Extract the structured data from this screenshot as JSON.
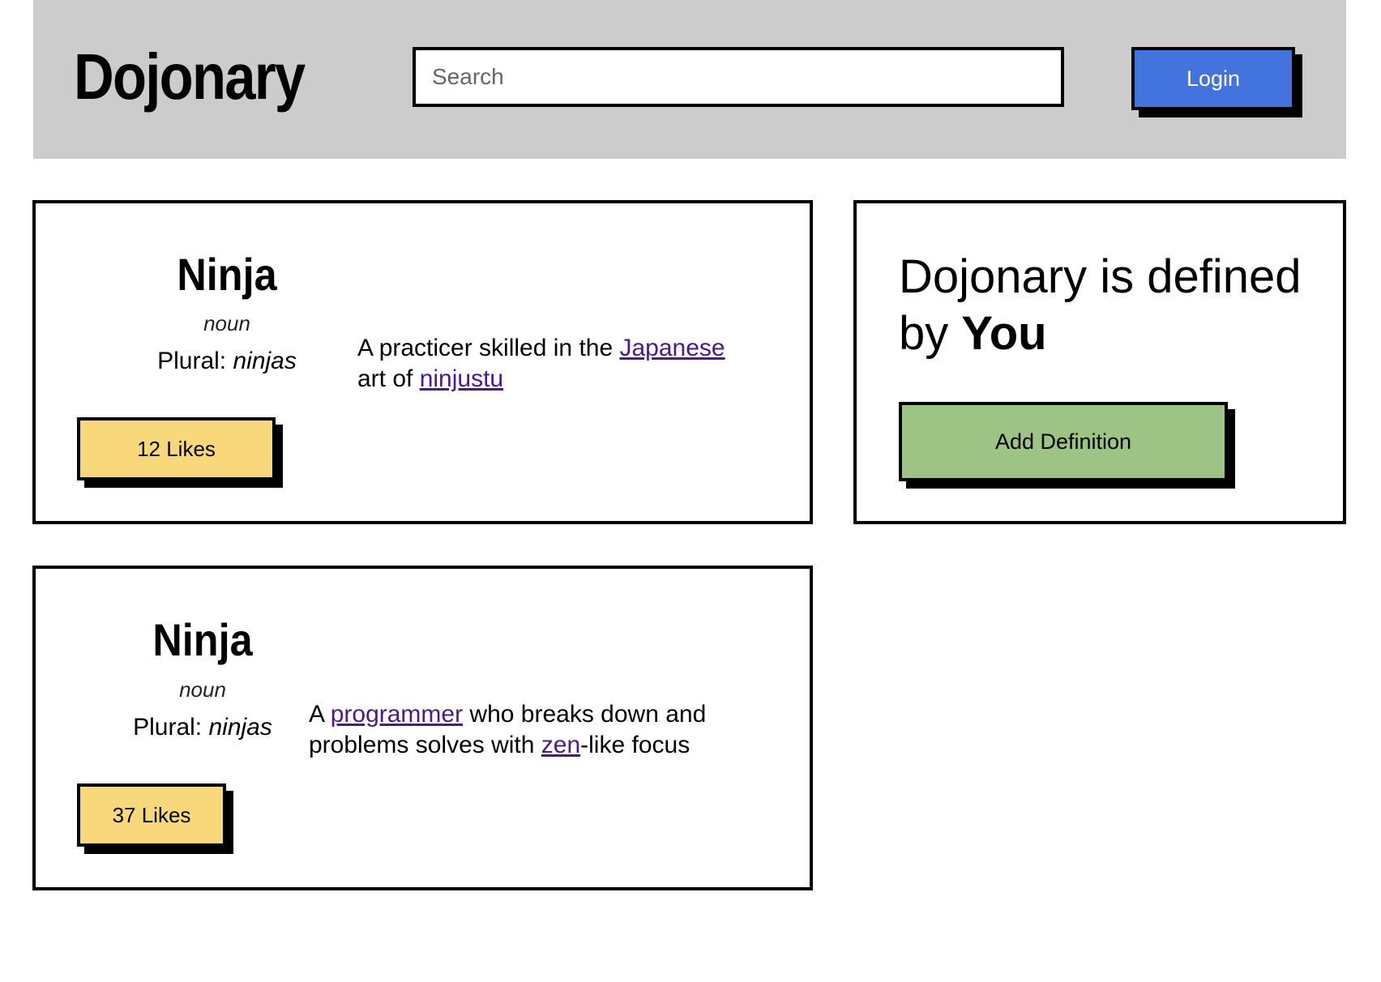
{
  "header": {
    "logo": "Dojonary",
    "search_placeholder": "Search",
    "login_label": "Login"
  },
  "definitions": [
    {
      "term": "Ninja",
      "part_of_speech": "noun",
      "plural_label": "Plural: ",
      "plural_value": "ninjas",
      "definition_parts": {
        "t1": "A practicer skilled in the ",
        "l1": "Japanese",
        "t2": " art of ",
        "l2": "ninjustu",
        "t3": ""
      },
      "likes_label": "12 Likes"
    },
    {
      "term": "Ninja",
      "part_of_speech": "noun",
      "plural_label": "Plural: ",
      "plural_value": "ninjas",
      "definition_parts": {
        "t1": "A ",
        "l1": "programmer",
        "t2": " who breaks down and problems solves with ",
        "l2": "zen",
        "t3": "-like focus"
      },
      "likes_label": "37 Likes"
    }
  ],
  "promo": {
    "title_prefix": "Dojonary is defined by ",
    "title_emphasis": "You",
    "add_definition_label": "Add Definition"
  },
  "colors": {
    "header_bg": "#cccccc",
    "login_bg": "#4374de",
    "likes_bg": "#f9d87b",
    "add_definition_bg": "#9dc385",
    "link": "#4b1a86"
  }
}
